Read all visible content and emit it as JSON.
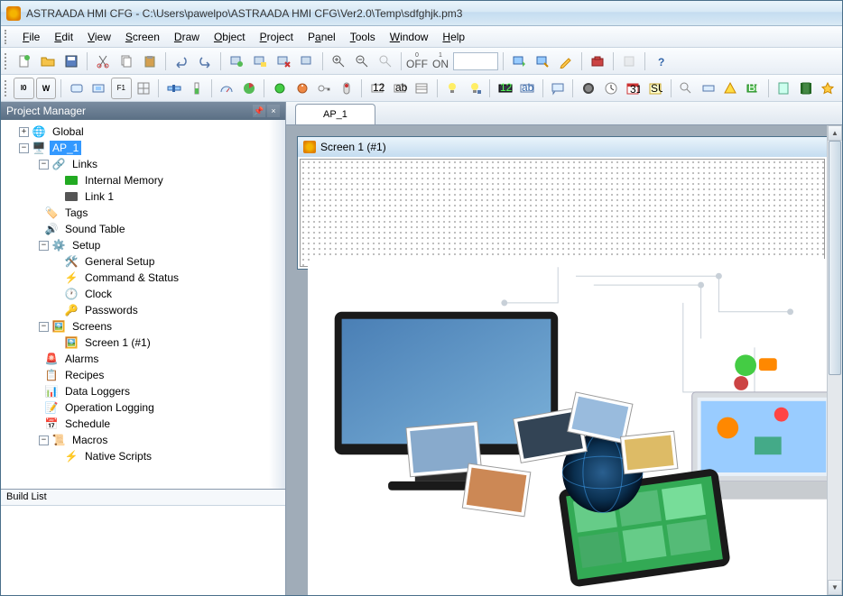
{
  "titlebar": {
    "title": "ASTRAADA HMI CFG - C:\\Users\\pawelpo\\ASTRAADA HMI CFG\\Ver2.0\\Temp\\sdfghjk.pm3"
  },
  "menu": {
    "file": "File",
    "edit": "Edit",
    "view": "View",
    "screen": "Screen",
    "draw": "Draw",
    "object": "Object",
    "project": "Project",
    "panel": "Panel",
    "tools": "Tools",
    "window": "Window",
    "help": "Help"
  },
  "toolbar": {
    "off": "OFF",
    "on": "ON",
    "zoom": ""
  },
  "project_manager": {
    "title": "Project Manager",
    "tree": {
      "global": "Global",
      "ap1": "AP_1",
      "links": "Links",
      "internal_memory": "Internal Memory",
      "link1": "Link 1",
      "tags": "Tags",
      "sound_table": "Sound Table",
      "setup": "Setup",
      "general_setup": "General Setup",
      "command_status": "Command & Status",
      "clock": "Clock",
      "passwords": "Passwords",
      "screens": "Screens",
      "screen1": "Screen 1 (#1)",
      "alarms": "Alarms",
      "recipes": "Recipes",
      "data_loggers": "Data Loggers",
      "operation_logging": "Operation Logging",
      "schedule": "Schedule",
      "macros": "Macros",
      "native_scripts": "Native Scripts"
    }
  },
  "build_list": {
    "title": "Build List"
  },
  "main_tab": {
    "label": "AP_1"
  },
  "screen_window": {
    "title": "Screen 1 (#1)"
  }
}
